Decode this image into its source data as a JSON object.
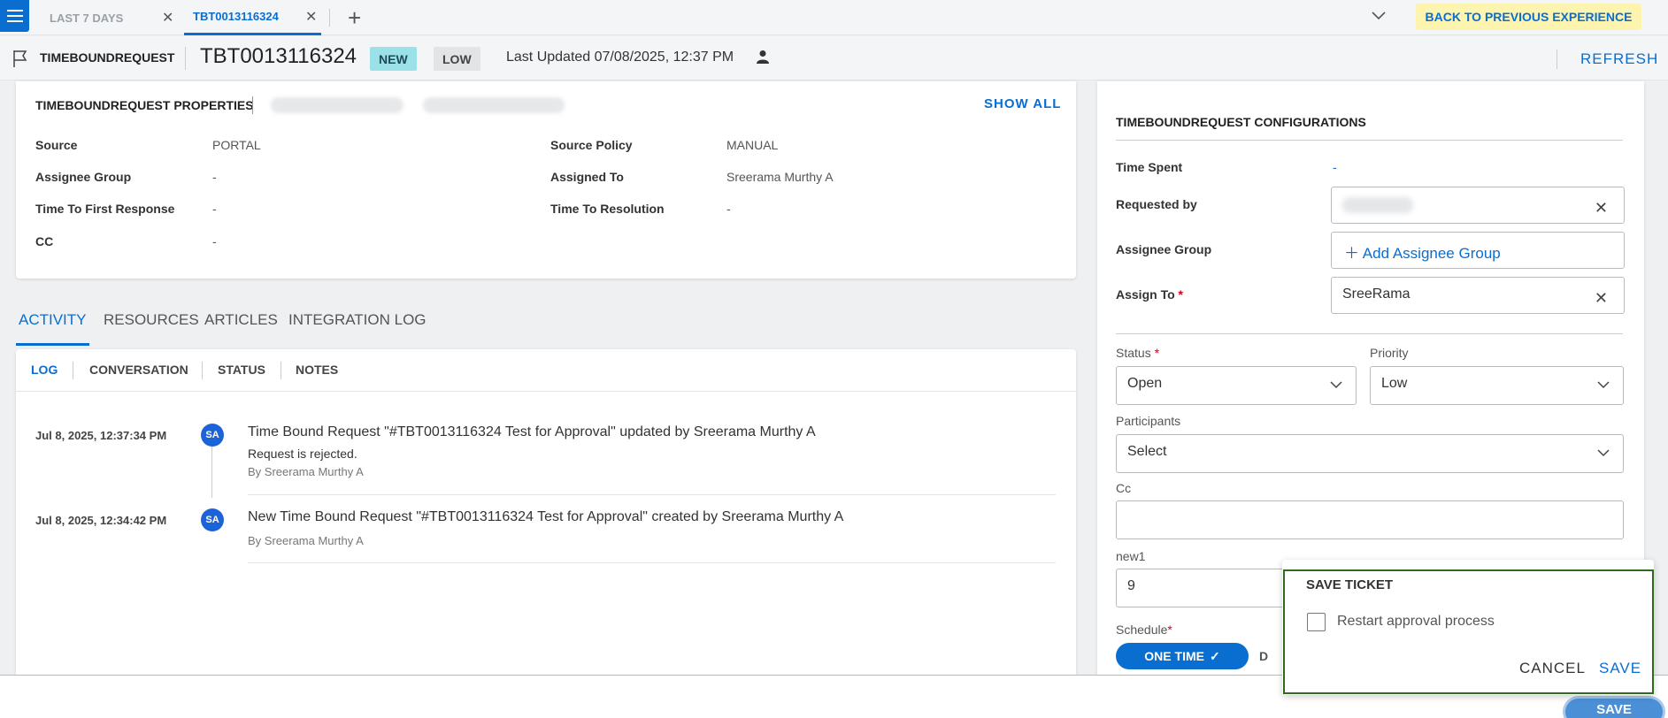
{
  "tabs": [
    {
      "label": "LAST 7 DAYS",
      "active": false
    },
    {
      "label": "TBT0013116324",
      "active": true
    }
  ],
  "top": {
    "back_label": "BACK TO PREVIOUS EXPERIENCE"
  },
  "header": {
    "type": "TIMEBOUNDREQUEST",
    "id": "TBT0013116324",
    "status_badge": "NEW",
    "priority_badge": "LOW",
    "last_updated": "Last Updated 07/08/2025, 12:37 PM",
    "refresh_label": "REFRESH"
  },
  "properties": {
    "title": "TIMEBOUNDREQUEST PROPERTIES",
    "show_all": "SHOW ALL",
    "fields": [
      {
        "label": "Source",
        "value": "PORTAL"
      },
      {
        "label": "Source Policy",
        "value": "MANUAL"
      },
      {
        "label": "Assignee Group",
        "value": "-"
      },
      {
        "label": "Assigned To",
        "value": "Sreerama Murthy A"
      },
      {
        "label": "Time To First Response",
        "value": "-"
      },
      {
        "label": "Time To Resolution",
        "value": "-"
      },
      {
        "label": "CC",
        "value": "-"
      }
    ]
  },
  "activity_tabs": [
    "ACTIVITY",
    "RESOURCES",
    "ARTICLES",
    "INTEGRATION LOG"
  ],
  "log": {
    "subtabs": [
      "LOG",
      "CONVERSATION",
      "STATUS",
      "NOTES"
    ],
    "entries": [
      {
        "timestamp": "Jul 8, 2025, 12:37:34 PM",
        "avatar": "SA",
        "title": "Time Bound Request \"#TBT0013116324 Test for Approval\" updated by Sreerama Murthy A",
        "detail": "Request is rejected.",
        "by": "By Sreerama Murthy A"
      },
      {
        "timestamp": "Jul 8, 2025, 12:34:42 PM",
        "avatar": "SA",
        "title": "New Time Bound Request \"#TBT0013116324 Test for Approval\" created by Sreerama Murthy A",
        "by": "By Sreerama Murthy A"
      }
    ]
  },
  "config": {
    "title": "TIMEBOUNDREQUEST CONFIGURATIONS",
    "time_spent_label": "Time Spent",
    "time_spent_value": "-",
    "requested_by_label": "Requested by",
    "assignee_group_label": "Assignee Group",
    "add_assignee_group": "Add Assignee Group",
    "assign_to_label": "Assign To",
    "assign_to_value": "SreeRama",
    "required_mark": "*",
    "status_label": "Status",
    "status_value": "Open",
    "priority_label": "Priority",
    "priority_value": "Low",
    "participants_label": "Participants",
    "participants_value": "Select",
    "cc_label": "Cc",
    "cc_value": "",
    "new1_label": "new1",
    "new1_value": "9",
    "schedule_label": "Schedule",
    "schedule_active": "ONE TIME",
    "schedule_other": "D"
  },
  "popup": {
    "title": "SAVE TICKET",
    "checkbox_label": "Restart approval process",
    "checked": false,
    "cancel": "CANCEL",
    "save": "SAVE"
  },
  "footer": {
    "save": "SAVE"
  },
  "colors": {
    "accent": "#0a6ed1",
    "new_badge": "#9be2e8",
    "back_button": "#fdf4b0",
    "popup_border": "#2e6b1f"
  }
}
